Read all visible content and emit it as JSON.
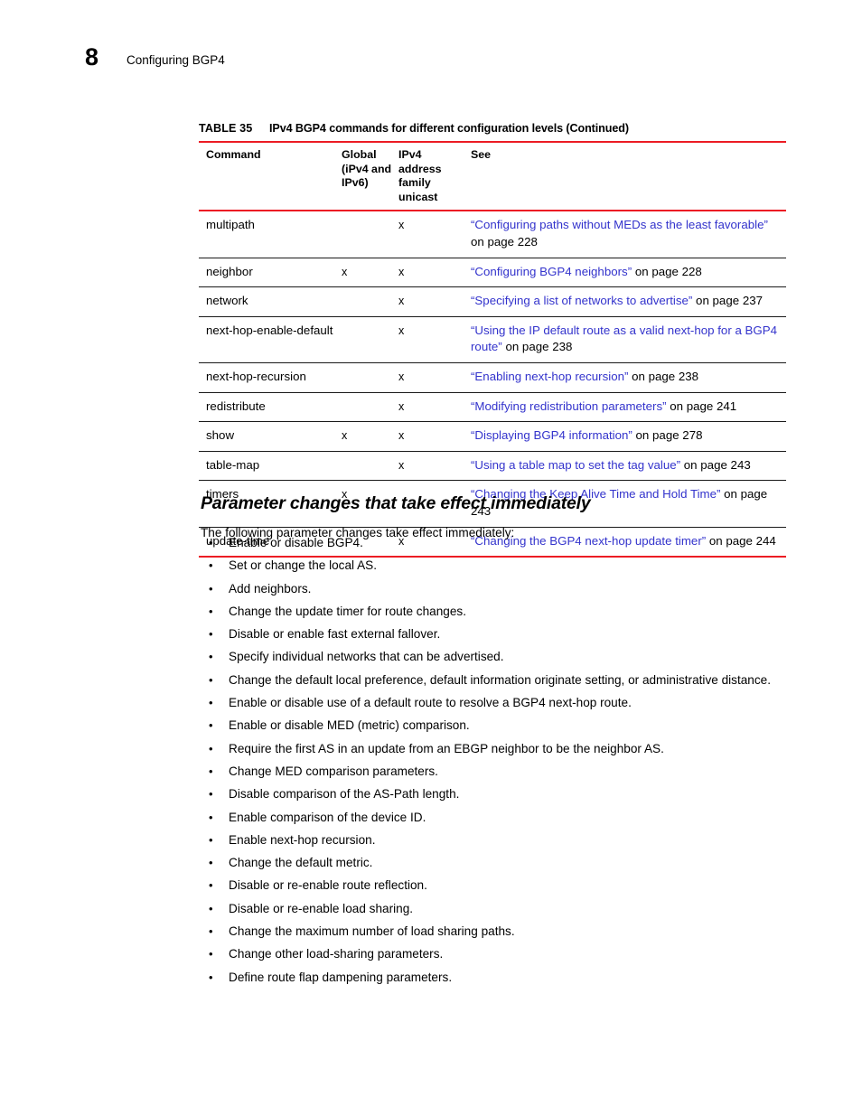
{
  "page": {
    "chapter_number": "8",
    "chapter_title": "Configuring BGP4"
  },
  "colors": {
    "rule_red": "#ec1c24",
    "cross_reference_link": "#3333cc",
    "body_text": "#000000"
  },
  "table": {
    "caption_label": "TABLE 35",
    "caption_text": "IPv4 BGP4 commands for different configuration levels  (Continued)",
    "columns": [
      "Command",
      "Global (iPv4 and IPv6)",
      "IPv4 address family unicast",
      "See"
    ],
    "headers": {
      "command": "Command",
      "global_line1": "Global",
      "global_line2": "(iPv4 and",
      "global_line3": "IPv6)",
      "ipv4_line1": "IPv4 address",
      "ipv4_line2": "family unicast",
      "see": "See"
    },
    "mark": "x",
    "rows": [
      {
        "command": "multipath",
        "global": "",
        "ipv4_af": "x",
        "see_link": "“Configuring paths without MEDs as the least favorable”",
        "see_tail": " on page 228"
      },
      {
        "command": "neighbor",
        "global": "x",
        "ipv4_af": "x",
        "see_link": "“Configuring BGP4 neighbors”",
        "see_tail": " on page 228"
      },
      {
        "command": "network",
        "global": "",
        "ipv4_af": "x",
        "see_link": "“Specifying a list of networks to advertise”",
        "see_tail": " on page 237"
      },
      {
        "command": "next-hop-enable-default",
        "global": "",
        "ipv4_af": "x",
        "see_link": "“Using the IP default route as a valid next-hop for a BGP4 route”",
        "see_tail": " on page 238"
      },
      {
        "command": "next-hop-recursion",
        "global": "",
        "ipv4_af": "x",
        "see_link": "“Enabling next-hop recursion”",
        "see_tail": " on page 238"
      },
      {
        "command": "redistribute",
        "global": "",
        "ipv4_af": "x",
        "see_link": "“Modifying redistribution parameters”",
        "see_tail": " on page 241"
      },
      {
        "command": "show",
        "global": "x",
        "ipv4_af": "x",
        "see_link": "“Displaying BGP4 information”",
        "see_tail": " on page 278"
      },
      {
        "command": "table-map",
        "global": "",
        "ipv4_af": "x",
        "see_link": "“Using a table map to set the tag value”",
        "see_tail": " on page 243"
      },
      {
        "command": "timers",
        "global": "x",
        "ipv4_af": "",
        "see_link": "“Changing the Keep Alive Time and Hold Time”",
        "see_tail": " on page 243"
      },
      {
        "command": "update-time",
        "global": "",
        "ipv4_af": "x",
        "see_link": "“Changing the BGP4 next-hop update timer”",
        "see_tail": " on page 244"
      }
    ]
  },
  "section": {
    "heading": "Parameter changes that take effect immediately",
    "intro": "The following parameter changes take effect immediately:",
    "bullet_glyph": "•",
    "bullets": [
      "Enable or disable BGP4.",
      "Set or change the local AS.",
      "Add neighbors.",
      "Change the update timer for route changes.",
      "Disable or enable fast external fallover.",
      "Specify individual networks that can be advertised.",
      "Change the default local preference, default information originate setting, or administrative distance.",
      "Enable or disable use of a default route to resolve a BGP4 next-hop route.",
      "Enable or disable MED (metric) comparison.",
      "Require the first AS in an update from an EBGP neighbor to be the neighbor AS.",
      "Change MED comparison parameters.",
      "Disable comparison of the AS-Path length.",
      "Enable comparison of the device ID.",
      "Enable next-hop recursion.",
      "Change the default metric.",
      "Disable or re-enable route reflection.",
      "Disable or re-enable load sharing.",
      "Change the maximum number of load sharing paths.",
      "Change other load-sharing parameters.",
      "Define route flap dampening parameters."
    ]
  }
}
